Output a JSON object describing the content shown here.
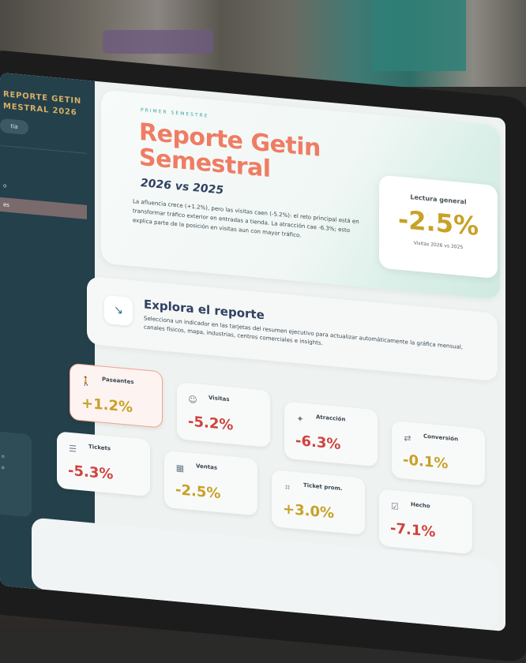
{
  "sidebar": {
    "title_line1": "REPORTE GETIN",
    "title_line2": "MESTRAL 2026",
    "chip": "tia",
    "items": [
      {
        "label": "",
        "active": false
      },
      {
        "label": "o",
        "active": false
      },
      {
        "label": "es",
        "active": true
      }
    ],
    "card_lines": [
      "n",
      "o"
    ]
  },
  "hero": {
    "kicker": "PRIMER SEMESTRE",
    "title": "Reporte Getin Semestral",
    "subtitle": "2026 vs 2025",
    "description": "La afluencia crece (+1.2%), pero las visitas caen (-5.2%): el reto principal está en transformar tráfico exterior en entradas a tienda. La atracción cae -6.3%; esto explica parte de la posición en visitas aun con mayor tráfico."
  },
  "kpi": {
    "label": "Lectura general",
    "value": "-2.5%",
    "note": "Visitas 2026 vs 2025"
  },
  "explore": {
    "icon": "pointer-icon",
    "title": "Explora el reporte",
    "description": "Selecciona un indicador en las tarjetas del resumen ejecutivo para actualizar automáticamente la gráfica mensual, canales físicos, mapa, industrias, centros comerciales e insights."
  },
  "metrics": [
    {
      "label": "Paseantes",
      "value": "+1.2%",
      "trend": "pos",
      "icon": "walker-icon",
      "selected": true
    },
    {
      "label": "Visitas",
      "value": "-5.2%",
      "trend": "neg",
      "icon": "visitor-icon",
      "selected": false
    },
    {
      "label": "Atracción",
      "value": "-6.3%",
      "trend": "neg",
      "icon": "attraction-icon",
      "selected": false
    },
    {
      "label": "Conversión",
      "value": "-0.1%",
      "trend": "pos",
      "icon": "conversion-icon",
      "selected": false
    },
    {
      "label": "Tickets",
      "value": "-5.3%",
      "trend": "neg",
      "icon": "ticket-icon",
      "selected": false
    },
    {
      "label": "Ventas",
      "value": "-2.5%",
      "trend": "pos",
      "icon": "sales-icon",
      "selected": false
    },
    {
      "label": "Ticket prom.",
      "value": "+3.0%",
      "trend": "pos",
      "icon": "avg-ticket-icon",
      "selected": false
    },
    {
      "label": "Hecho",
      "value": "-7.1%",
      "trend": "neg",
      "icon": "done-icon",
      "selected": false
    }
  ]
}
